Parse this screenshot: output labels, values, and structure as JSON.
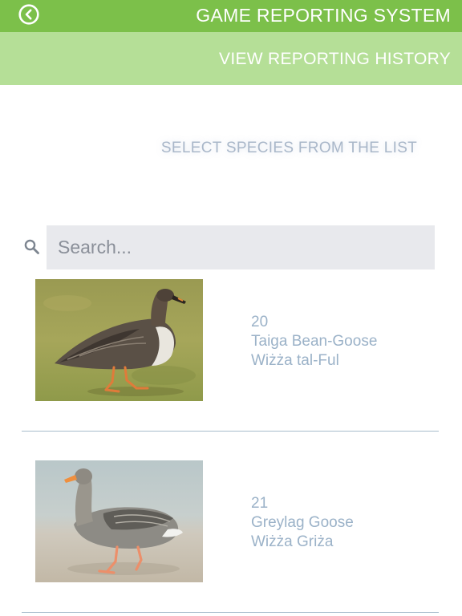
{
  "header": {
    "title": "GAME REPORTING SYSTEM",
    "history_link": "VIEW REPORTING HISTORY"
  },
  "instruction": "SELECT SPECIES FROM THE LIST",
  "search": {
    "placeholder": "Search...",
    "value": ""
  },
  "species": [
    {
      "number": "20",
      "english_name": "Taiga Bean-Goose",
      "maltese_name": "Wiżża tal-Ful"
    },
    {
      "number": "21",
      "english_name": "Greylag Goose",
      "maltese_name": "Wiżża Griża"
    }
  ],
  "colors": {
    "header_green": "#7cc04a",
    "subheader_green": "#b5df97",
    "species_text": "#9bb2c8",
    "divider": "#a7bccc",
    "search_bg": "#e8e9ed"
  },
  "icons": {
    "back": "back-chevron-circle-icon",
    "search": "search-icon"
  }
}
